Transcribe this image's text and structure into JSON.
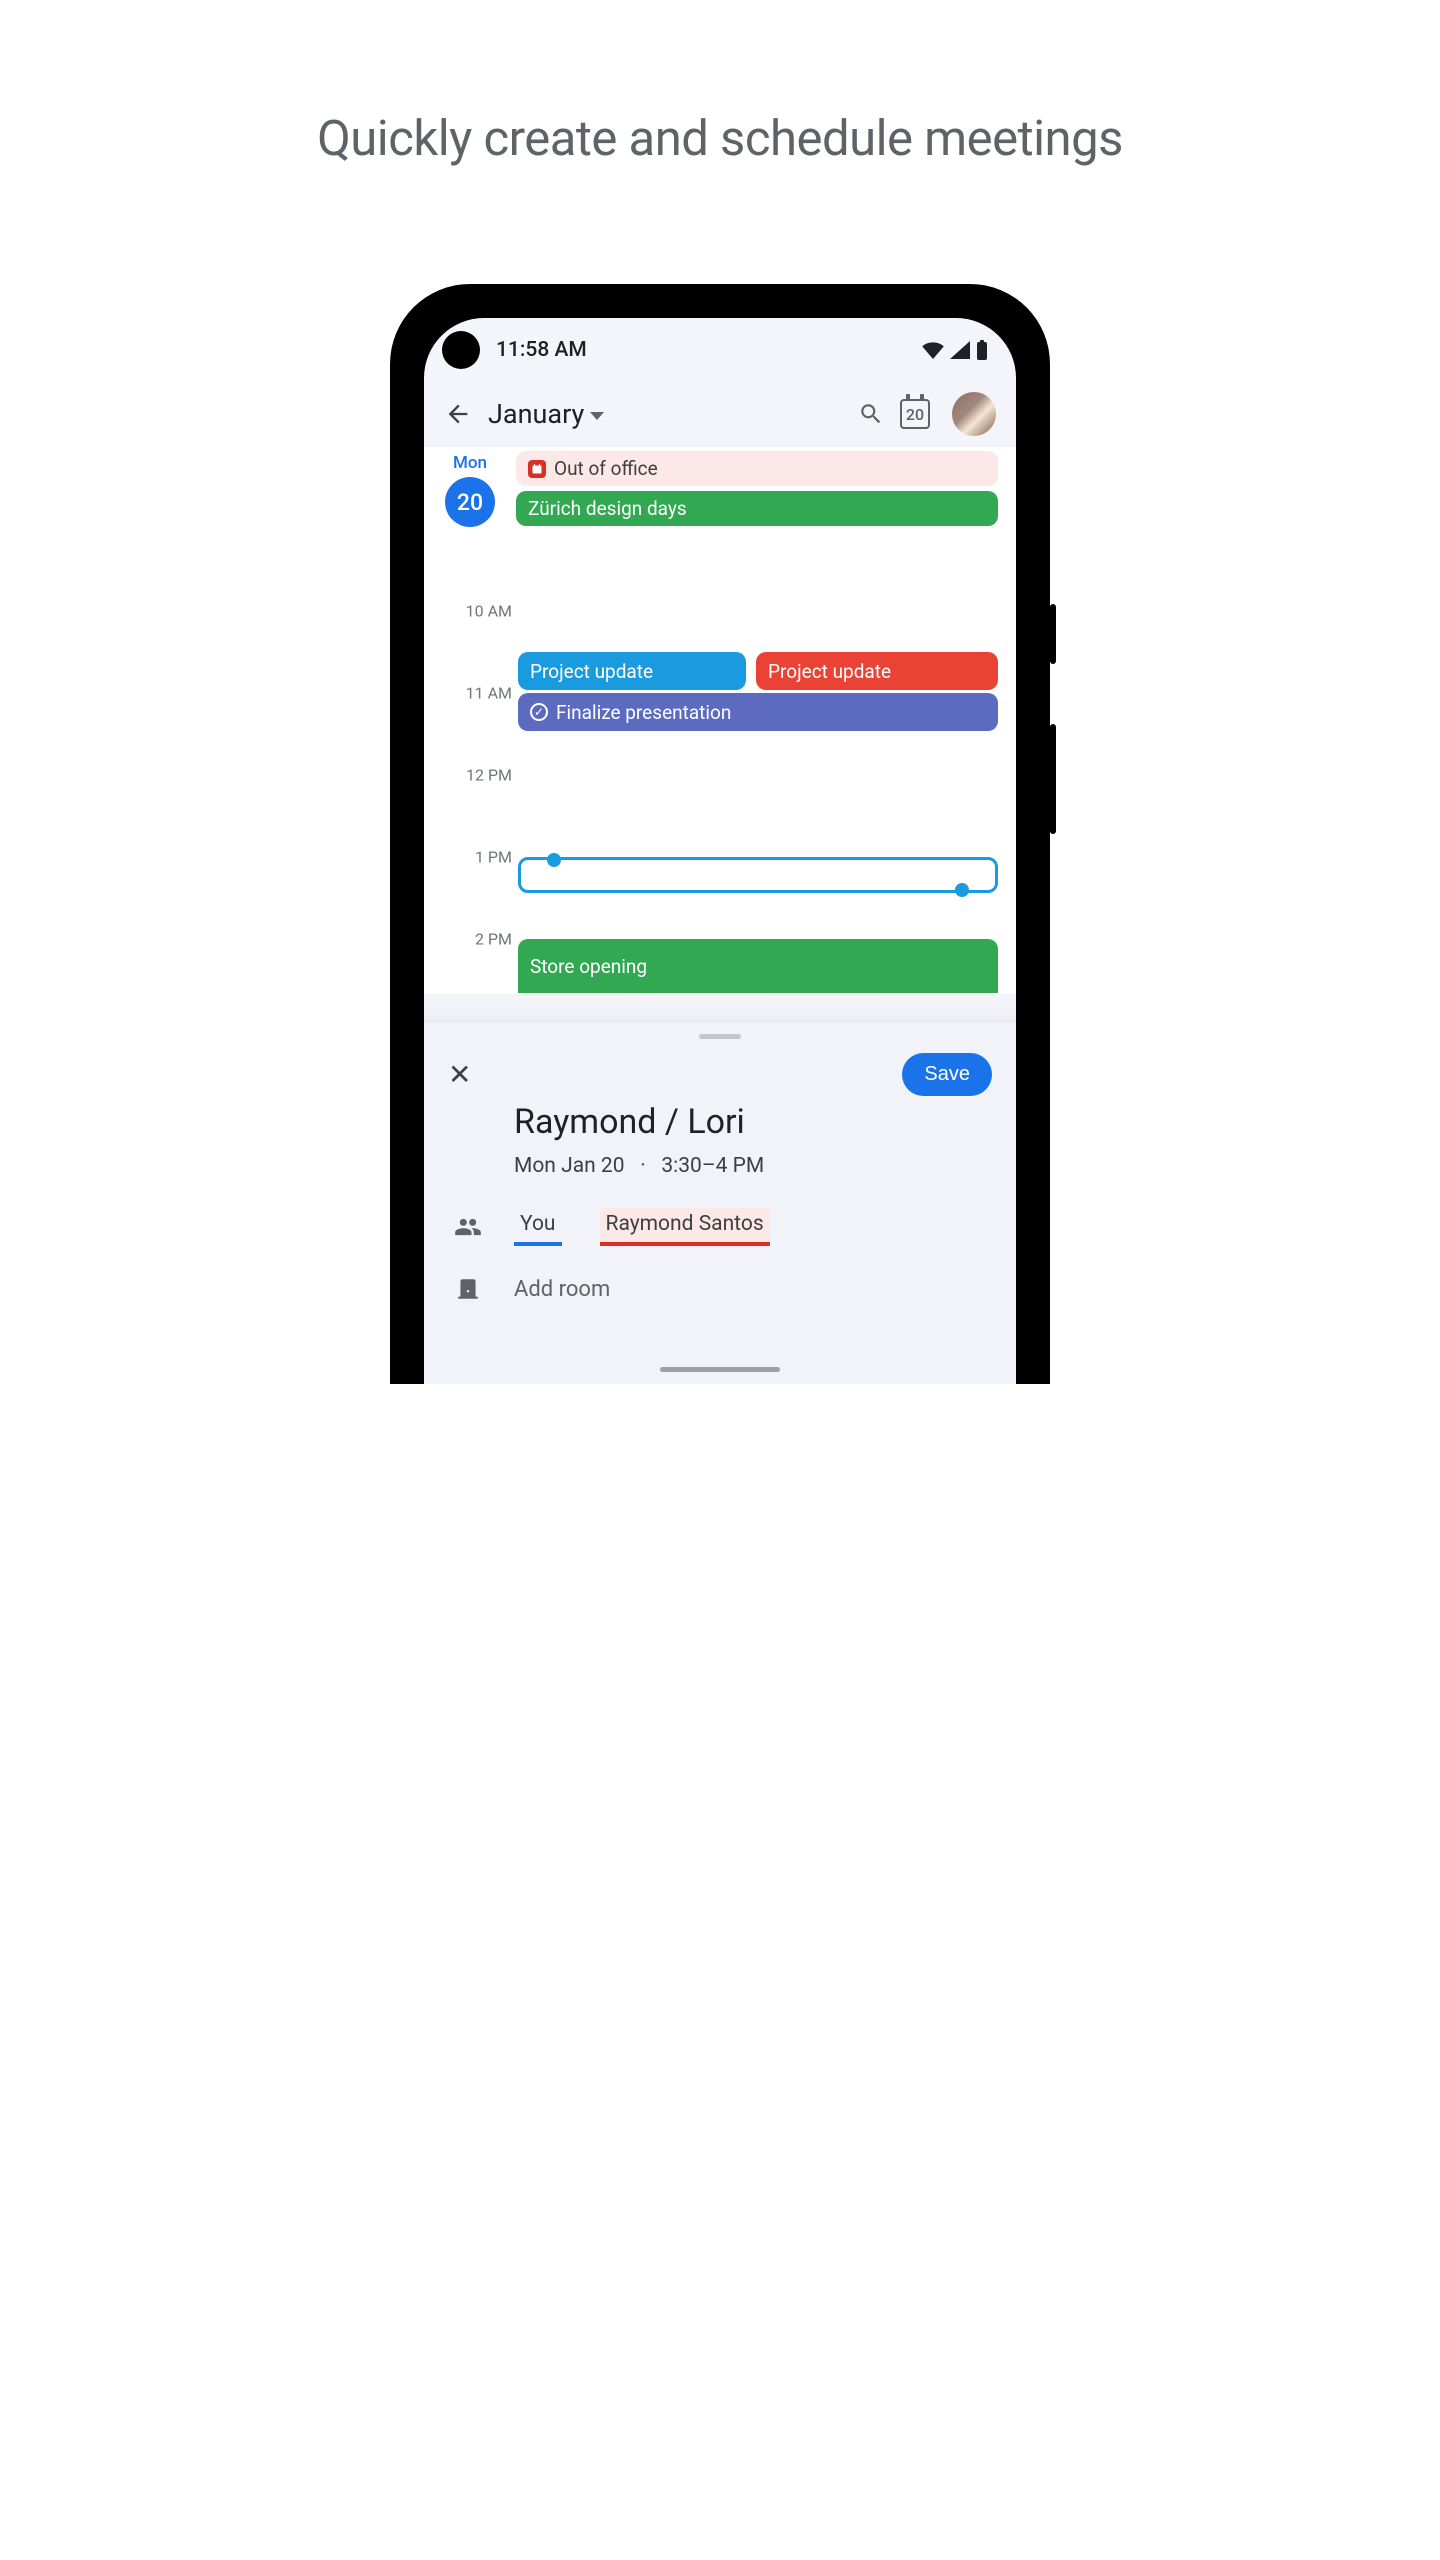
{
  "headline": "Quickly create and schedule meetings",
  "status": {
    "time": "11:58 AM"
  },
  "appbar": {
    "month": "January",
    "today_date": "20"
  },
  "day_header": {
    "weekday": "Mon",
    "day": "20"
  },
  "all_day_events": {
    "ooo": "Out of office",
    "zurich": "Zürich design days"
  },
  "time_labels": {
    "t10": "10 AM",
    "t11": "11 AM",
    "t12": "12 PM",
    "t13": "1 PM",
    "t14": "2 PM"
  },
  "timed_events": {
    "proj_update_a": "Project update",
    "proj_update_b": "Project update",
    "finalize": "Finalize presentation",
    "store": "Store opening"
  },
  "sheet": {
    "save_label": "Save",
    "title": "Raymond / Lori",
    "date": "Mon Jan 20",
    "separator": "·",
    "timerange": "3:30–4 PM",
    "attendee_you": "You",
    "attendee_other": "Raymond Santos",
    "add_room": "Add room"
  }
}
